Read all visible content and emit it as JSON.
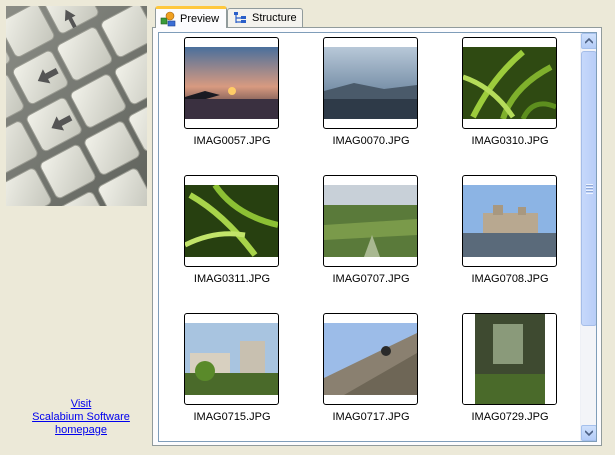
{
  "left_panel": {
    "link_lines": [
      "Visit",
      "Scalabium Software",
      "homepage"
    ]
  },
  "tabs": [
    {
      "label": "Preview",
      "icon": "preview-icon",
      "active": true
    },
    {
      "label": "Structure",
      "icon": "structure-icon",
      "active": false
    }
  ],
  "thumbnails": [
    {
      "label": "IMAG0057.JPG"
    },
    {
      "label": "IMAG0070.JPG"
    },
    {
      "label": "IMAG0310.JPG"
    },
    {
      "label": "IMAG0311.JPG"
    },
    {
      "label": "IMAG0707.JPG"
    },
    {
      "label": "IMAG0708.JPG"
    },
    {
      "label": "IMAG0715.JPG"
    },
    {
      "label": "IMAG0717.JPG"
    },
    {
      "label": "IMAG0729.JPG"
    }
  ],
  "colors": {
    "link": "#0000ee",
    "active_tab_accent": "#ffc83c",
    "panel_background": "#ece9d8"
  }
}
